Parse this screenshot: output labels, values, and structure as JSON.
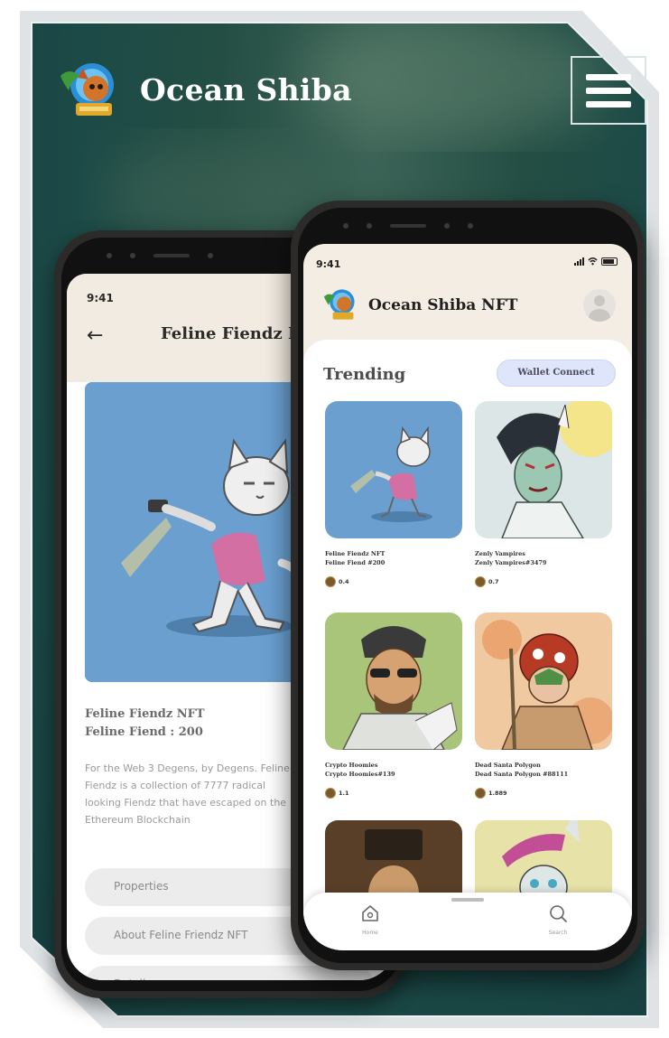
{
  "brand": {
    "title": "Ocean Shiba"
  },
  "colors": {
    "background": "#1c4a47",
    "accent": "#dfe5fa",
    "header_bg": "#f2ebe1",
    "nft_blue": "#6a9fcf"
  },
  "icons": {
    "menu": "hamburger-menu-icon",
    "back": "arrow-left-icon",
    "home": "home-icon",
    "search": "search-icon",
    "profile": "user-avatar-icon"
  },
  "back_phone": {
    "time": "9:41",
    "back_arrow": "←",
    "title": "Feline Fiendz NFT",
    "nft_collection": "Feline Fiendz NFT",
    "nft_name": "Feline Fiend : 200",
    "description": "For the Web 3 Degens, by Degens. Feline Fiendz is a collection of 7777 radical looking Fiendz that have escaped on the Ethereum Blockchain",
    "accordion": [
      "Properties",
      "About Feline Friendz NFT",
      "Detail"
    ]
  },
  "front_phone": {
    "time": "9:41",
    "app_title": "Ocean Shiba NFT",
    "section_title": "Trending",
    "wallet_button": "Wallet Connect",
    "cards": [
      {
        "collection": "Feline Fiendz NFT",
        "name": "Feline Fiend #200",
        "price": "0.4"
      },
      {
        "collection": "Zenly Vampires",
        "name": "Zenly Vampires#3479",
        "price": "0.7"
      },
      {
        "collection": "Crypto Hoomies",
        "name": "Crypto Hoomies#139",
        "price": "1.1"
      },
      {
        "collection": "Dead Santa Polygon",
        "name": "Dead Santa Polygon #88111",
        "price": "1.889"
      },
      {
        "collection": "",
        "name": "",
        "price": ""
      },
      {
        "collection": "",
        "name": "",
        "price": ""
      }
    ],
    "tabs": [
      {
        "label": "Home"
      },
      {
        "label": "Search"
      }
    ]
  }
}
